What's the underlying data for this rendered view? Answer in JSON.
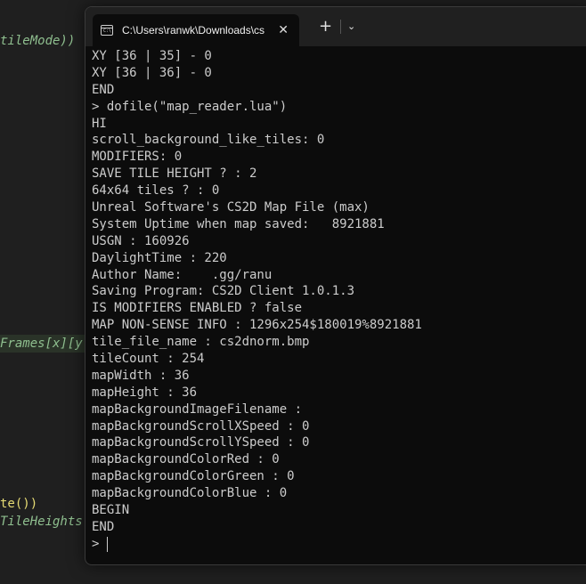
{
  "editor": {
    "lines": [
      "tileMode))",
      "Frames[x][y",
      "te())",
      "TileHeights"
    ]
  },
  "terminal": {
    "tab_title": "C:\\Users\\ranwk\\Downloads\\cs",
    "tab_icon_text": "C:\\",
    "close_glyph": "✕",
    "new_tab_glyph": "+",
    "dropdown_glyph": "⌄",
    "lines": [
      "XY [36 | 35] - 0",
      "XY [36 | 36] - 0",
      "END",
      "> dofile(\"map_reader.lua\")",
      "HI",
      "scroll_background_like_tiles: 0",
      "MODIFIERS: 0",
      "SAVE TILE HEIGHT ? : 2",
      "64x64 tiles ? : 0",
      "Unreal Software's CS2D Map File (max)",
      "System Uptime when map saved:   8921881",
      "USGN : 160926",
      "DaylightTime : 220",
      "Author Name:    .gg/ranu",
      "Saving Program: CS2D Client 1.0.1.3",
      "IS MODIFIERS ENABLED ? false",
      "MAP NON-SENSE INFO : 1296x254$180019%8921881",
      "tile_file_name : cs2dnorm.bmp",
      "tileCount : 254",
      "mapWidth : 36",
      "mapHeight : 36",
      "mapBackgroundImageFilename :",
      "mapBackgroundScrollXSpeed : 0",
      "mapBackgroundScrollYSpeed : 0",
      "mapBackgroundColorRed : 0",
      "mapBackgroundColorGreen : 0",
      "mapBackgroundColorBlue : 0",
      "BEGIN",
      "END"
    ],
    "prompt": ">"
  }
}
